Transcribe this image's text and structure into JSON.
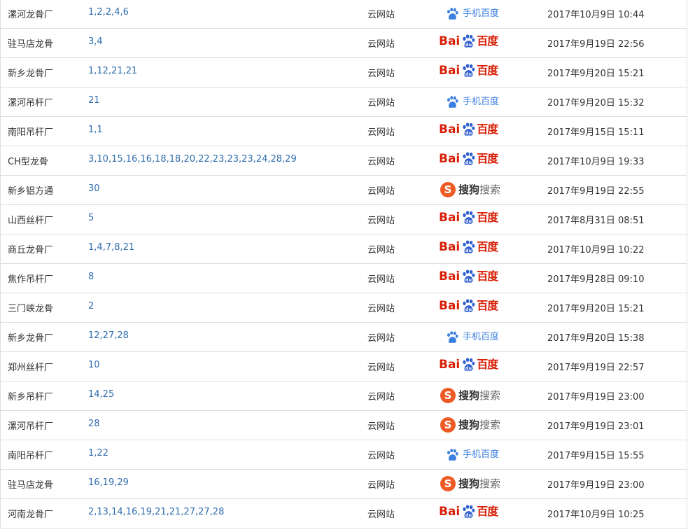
{
  "colors": {
    "link": "#2f6dae",
    "text": "#333333",
    "border": "#dddddd",
    "baidu_red": "#d81e06",
    "baidu_blue": "#2f5fd0",
    "mobile_blue": "#3b7fe0",
    "sogou_orange": "#ee5a24"
  },
  "engines": {
    "baidu": {
      "icon": "baidu-logo-icon",
      "text_left": "Bai",
      "text_mid": "du",
      "text_cn": "百度"
    },
    "mobile_baidu": {
      "icon": "mobile-baidu-paw-icon",
      "text": "手机百度"
    },
    "sogou": {
      "icon": "sogou-logo-icon",
      "letter": "S",
      "text_a": "搜狗",
      "text_b": "搜索"
    }
  },
  "rows": [
    {
      "name": "漯河龙骨厂",
      "keys": "1,2,2,4,6",
      "source": "云网站",
      "engine": "mobile_baidu",
      "time": "2017年10月9日 10:44"
    },
    {
      "name": "驻马店龙骨",
      "keys": "3,4",
      "source": "云网站",
      "engine": "baidu",
      "time": "2017年9月19日 22:56"
    },
    {
      "name": "新乡龙骨厂",
      "keys": "1,12,21,21",
      "source": "云网站",
      "engine": "baidu",
      "time": "2017年9月20日 15:21"
    },
    {
      "name": "漯河吊杆厂",
      "keys": "21",
      "source": "云网站",
      "engine": "mobile_baidu",
      "time": "2017年9月20日 15:32"
    },
    {
      "name": "南阳吊杆厂",
      "keys": "1,1",
      "source": "云网站",
      "engine": "baidu",
      "time": "2017年9月15日 15:11"
    },
    {
      "name": "CH型龙骨",
      "keys": "3,10,15,16,16,18,18,20,22,23,23,23,24,28,29",
      "source": "云网站",
      "engine": "baidu",
      "time": "2017年10月9日 19:33"
    },
    {
      "name": "新乡铝方通",
      "keys": "30",
      "source": "云网站",
      "engine": "sogou",
      "time": "2017年9月19日 22:55"
    },
    {
      "name": "山西丝杆厂",
      "keys": "5",
      "source": "云网站",
      "engine": "baidu",
      "time": "2017年8月31日 08:51"
    },
    {
      "name": "商丘龙骨厂",
      "keys": "1,4,7,8,21",
      "source": "云网站",
      "engine": "baidu",
      "time": "2017年10月9日 10:22"
    },
    {
      "name": "焦作吊杆厂",
      "keys": "8",
      "source": "云网站",
      "engine": "baidu",
      "time": "2017年9月28日 09:10"
    },
    {
      "name": "三门峡龙骨",
      "keys": "2",
      "source": "云网站",
      "engine": "baidu",
      "time": "2017年9月20日 15:21"
    },
    {
      "name": "新乡龙骨厂",
      "keys": "12,27,28",
      "source": "云网站",
      "engine": "mobile_baidu",
      "time": "2017年9月20日 15:38"
    },
    {
      "name": "郑州丝杆厂",
      "keys": "10",
      "source": "云网站",
      "engine": "baidu",
      "time": "2017年9月19日 22:57"
    },
    {
      "name": "新乡吊杆厂",
      "keys": "14,25",
      "source": "云网站",
      "engine": "sogou",
      "time": "2017年9月19日 23:00"
    },
    {
      "name": "漯河吊杆厂",
      "keys": "28",
      "source": "云网站",
      "engine": "sogou",
      "time": "2017年9月19日 23:01"
    },
    {
      "name": "南阳吊杆厂",
      "keys": "1,22",
      "source": "云网站",
      "engine": "mobile_baidu",
      "time": "2017年9月15日 15:55"
    },
    {
      "name": "驻马店龙骨",
      "keys": "16,19,29",
      "source": "云网站",
      "engine": "sogou",
      "time": "2017年9月19日 23:00"
    },
    {
      "name": "河南龙骨厂",
      "keys": "2,13,14,16,19,21,21,27,27,28",
      "source": "云网站",
      "engine": "baidu",
      "time": "2017年10月9日 10:25"
    }
  ]
}
